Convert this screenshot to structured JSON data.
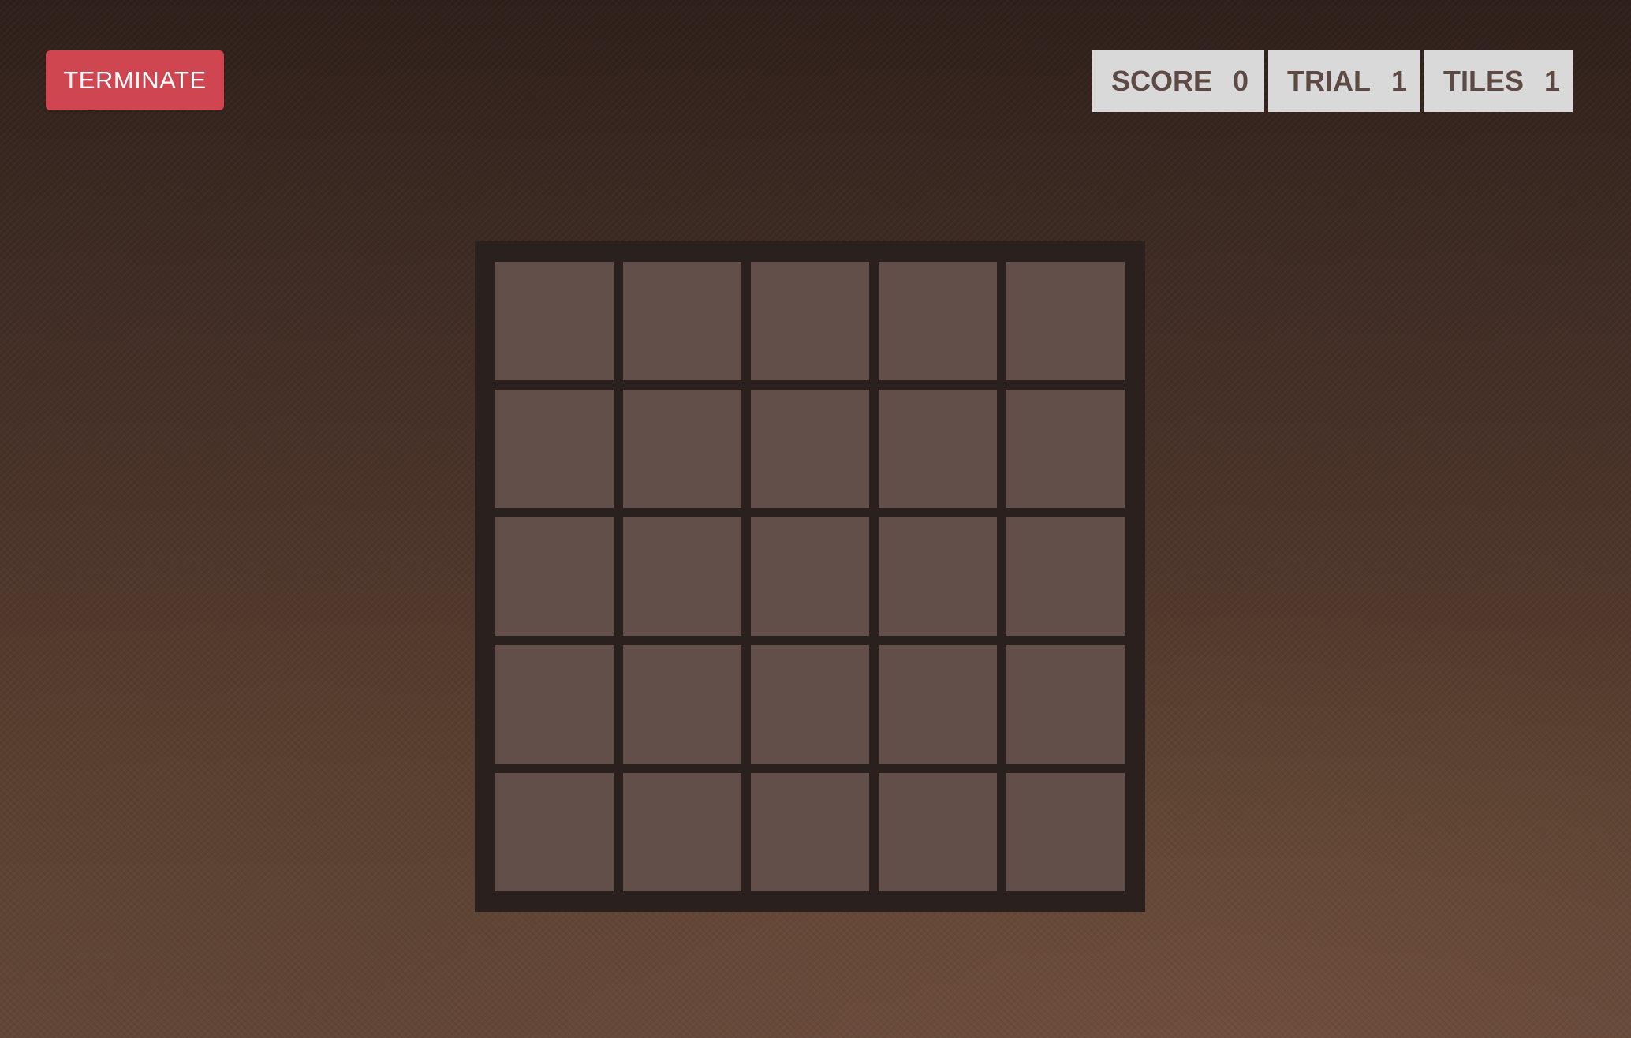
{
  "controls": {
    "terminate_label": "TERMINATE"
  },
  "stats": {
    "score": {
      "label": "SCORE",
      "value": "0"
    },
    "trial": {
      "label": "TRIAL",
      "value": "1"
    },
    "tiles": {
      "label": "TILES",
      "value": "1"
    }
  },
  "board": {
    "rows": 5,
    "cols": 5,
    "frame_color": "#2a211e",
    "tile_color": "#634f49"
  },
  "colors": {
    "terminate_button": "#cf4550",
    "stat_box_bg": "#d9d9d9",
    "stat_text": "#5e4a45"
  }
}
